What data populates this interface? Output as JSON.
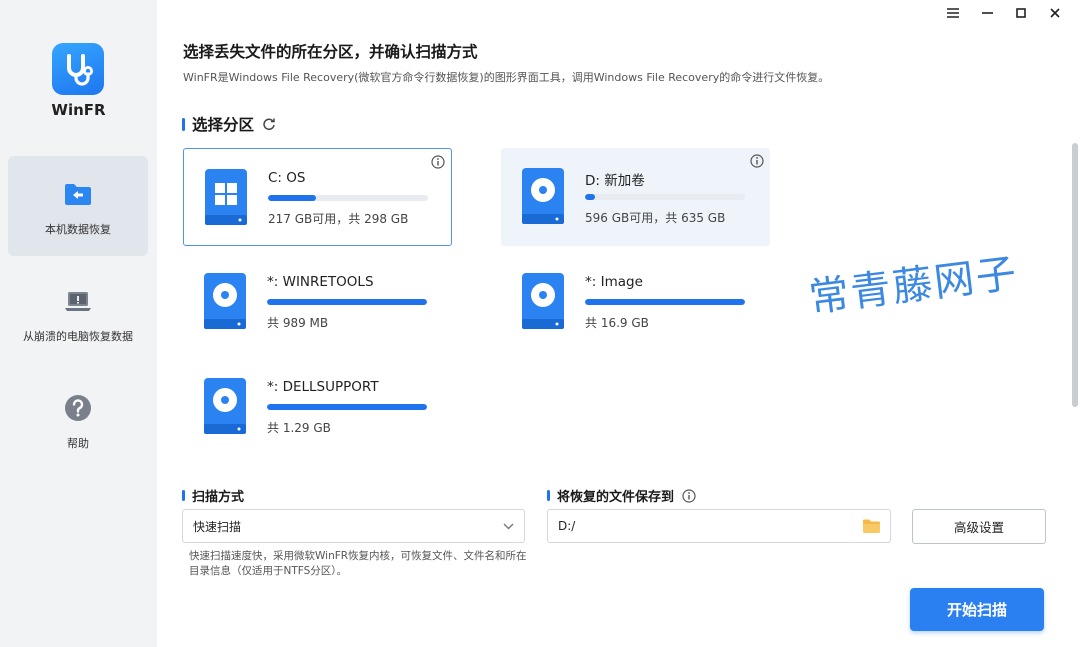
{
  "app": {
    "name": "WinFR"
  },
  "sidebar": {
    "items": [
      {
        "label": "本机数据恢复",
        "icon": "folder-back-icon",
        "active": true
      },
      {
        "label": "从崩溃的电脑恢复数据",
        "icon": "laptop-warning-icon",
        "active": false
      },
      {
        "label": "帮助",
        "icon": "help-icon",
        "active": false
      }
    ]
  },
  "main": {
    "title": "选择丢失文件的所在分区，并确认扫描方式",
    "subtitle": "WinFR是Windows File Recovery(微软官方命令行数据恢复)的图形界面工具，调用Windows File Recovery的命令进行文件恢复。"
  },
  "partitions": {
    "heading": "选择分区",
    "items": [
      {
        "name": "C: OS",
        "capacity": "217 GB可用，共 298 GB",
        "used_fraction": 0.3,
        "icon": "windows-drive-icon",
        "selected": true,
        "info": true
      },
      {
        "name": "D: 新加卷",
        "capacity": "596 GB可用，共 635 GB",
        "used_fraction": 0.06,
        "icon": "disk-drive-icon",
        "selected": false,
        "info": true
      },
      {
        "name": "*: WINRETOOLS",
        "capacity": "共 989 MB",
        "used_fraction": 1.0,
        "icon": "disk-drive-icon",
        "selected": false,
        "info": false
      },
      {
        "name": "*: Image",
        "capacity": "共 16.9 GB",
        "used_fraction": 1.0,
        "icon": "disk-drive-icon",
        "selected": false,
        "info": false
      },
      {
        "name": "*: DELLSUPPORT",
        "capacity": "共 1.29 GB",
        "used_fraction": 1.0,
        "icon": "disk-drive-icon",
        "selected": false,
        "info": false
      }
    ]
  },
  "scan": {
    "heading": "扫描方式",
    "selected": "快速扫描",
    "note": "快速扫描速度快，采用微软WinFR恢复内核，可恢复文件、文件名和所在目录信息（仅适用于NTFS分区）。"
  },
  "save": {
    "heading": "将恢复的文件保存到",
    "path": "D:/"
  },
  "buttons": {
    "advanced": "高级设置",
    "start": "开始扫描"
  },
  "watermark": "常青藤网子",
  "colors": {
    "accent": "#1f74ee",
    "sidebar_bg": "#f2f3f5"
  }
}
